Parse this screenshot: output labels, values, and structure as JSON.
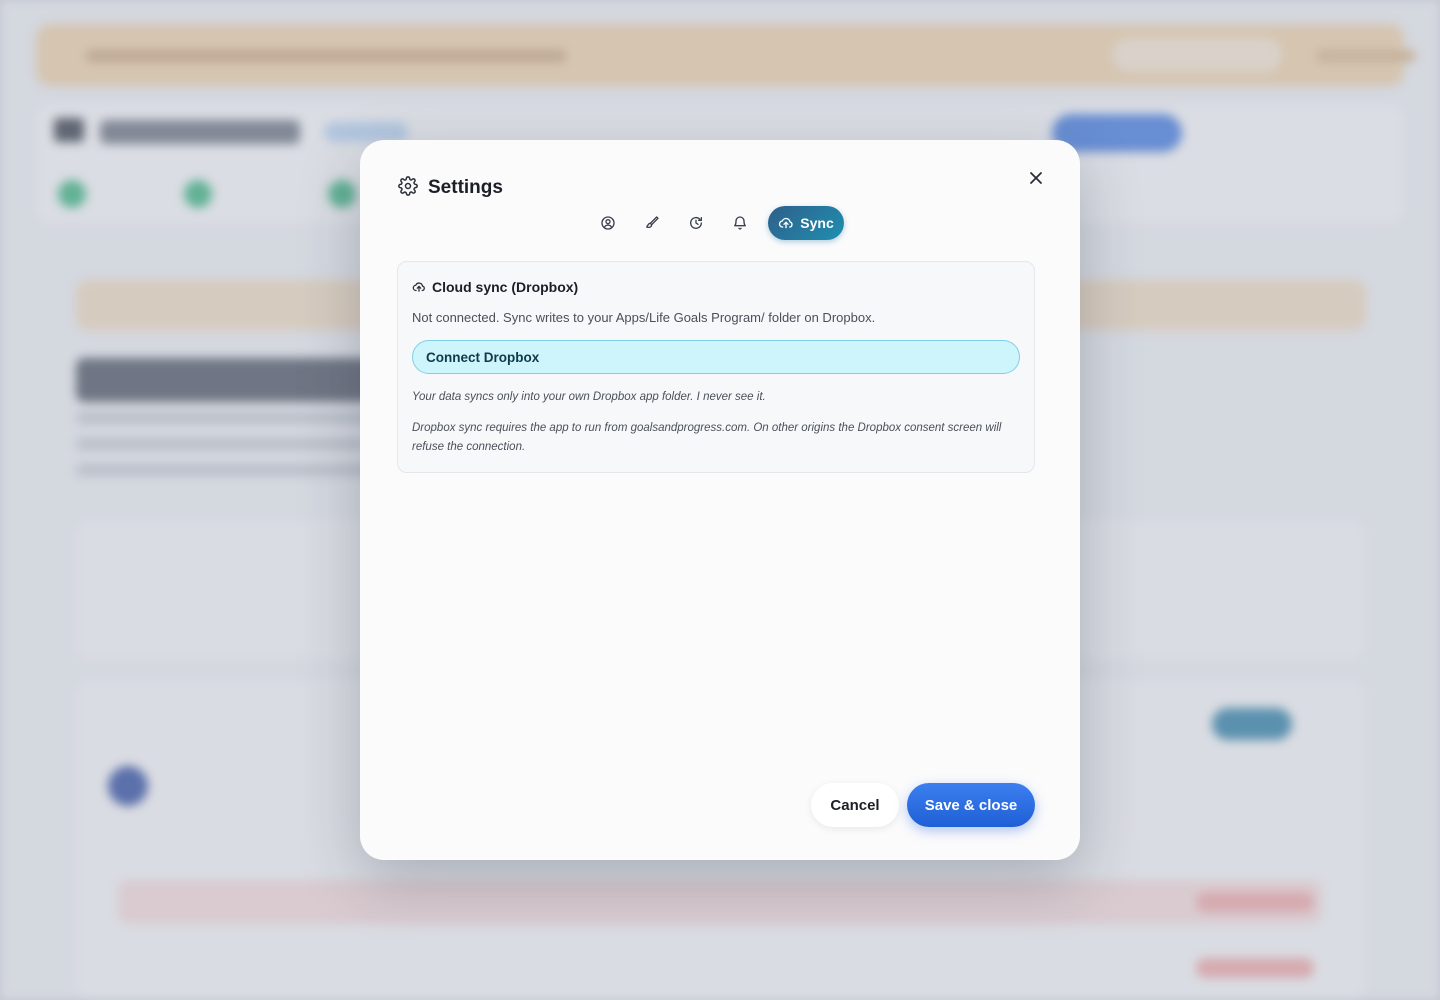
{
  "modal": {
    "title": "Settings",
    "close_icon": "close-icon",
    "tabs": [
      {
        "icon": "user-circle-icon",
        "label": ""
      },
      {
        "icon": "brush-icon",
        "label": ""
      },
      {
        "icon": "refresh-clock-icon",
        "label": ""
      },
      {
        "icon": "bell-icon",
        "label": ""
      },
      {
        "icon": "cloud-upload-icon",
        "label": "Sync",
        "active": true
      }
    ],
    "sync": {
      "heading": "Cloud sync (Dropbox)",
      "status": "Not connected. Sync writes to your Apps/Life Goals Program/ folder on Dropbox.",
      "connect_label": "Connect Dropbox",
      "note1": "Your data syncs only into your own Dropbox app folder. I never see it.",
      "note2": "Dropbox sync requires the app to run from goalsandprogress.com. On other origins the Dropbox consent screen will refuse the connection."
    },
    "footer": {
      "cancel_label": "Cancel",
      "save_label": "Save & close"
    }
  },
  "colors": {
    "accent": "#1f5fd6",
    "active_tab": "#1f8fb0",
    "connect_bg": "#cdf5fb"
  }
}
